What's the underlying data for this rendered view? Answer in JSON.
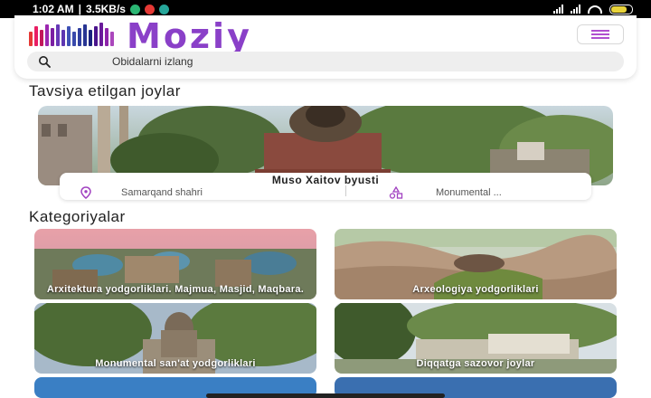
{
  "status": {
    "time": "1:02 AM",
    "network_speed": "3.5KB/s",
    "battery_level": 0.75,
    "battery_color": "#e8d33a"
  },
  "header": {
    "app_name": "Moziy",
    "brand_color": "#8a40c8",
    "menu_icon": "hamburger-icon"
  },
  "search": {
    "placeholder": "Obidalarni izlang",
    "icon": "search-icon"
  },
  "recommended": {
    "title": "Tavsiya etilgan joylar",
    "item": {
      "name": "Muso Xaitov byusti",
      "location": "Samarqand shahri",
      "category": "Monumental ...",
      "location_icon": "map-pin-icon",
      "category_icon": "category-shapes-icon"
    }
  },
  "categories": {
    "title": "Kategoriyalar",
    "items": [
      {
        "label": "Arxitektura yodgorliklari. Majmua, Masjid, Maqbara."
      },
      {
        "label": "Arxeologiya yodgorliklari"
      },
      {
        "label": "Monumental san'at yodgorliklari"
      },
      {
        "label": "Diqqatga sazovor joylar"
      }
    ]
  }
}
